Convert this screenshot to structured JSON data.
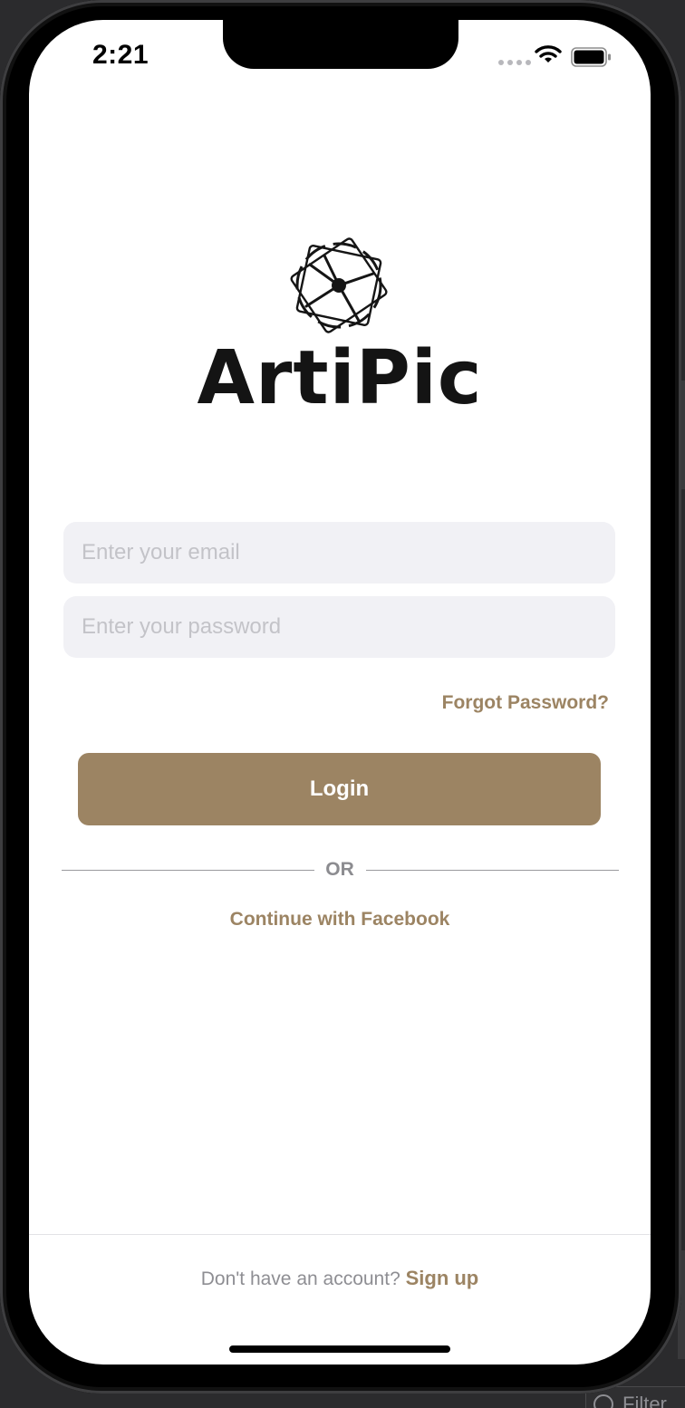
{
  "status_bar": {
    "time": "2:21",
    "icons": [
      "cellular-signal-icon",
      "wifi-icon",
      "battery-icon"
    ]
  },
  "brand": {
    "name": "ArtiPic",
    "logo_icon": "camera-aperture-icon",
    "accent_color": "#9c8463"
  },
  "form": {
    "email_placeholder": "Enter your email",
    "email_value": "",
    "password_placeholder": "Enter your password",
    "password_value": "",
    "forgot_password_label": "Forgot Password?",
    "login_label": "Login",
    "or_label": "OR",
    "facebook_label": "Continue with Facebook"
  },
  "footer": {
    "prompt": "Don't have an account? ",
    "signup_label": "Sign up"
  },
  "editor_chrome": {
    "filter_label": "Filter"
  }
}
